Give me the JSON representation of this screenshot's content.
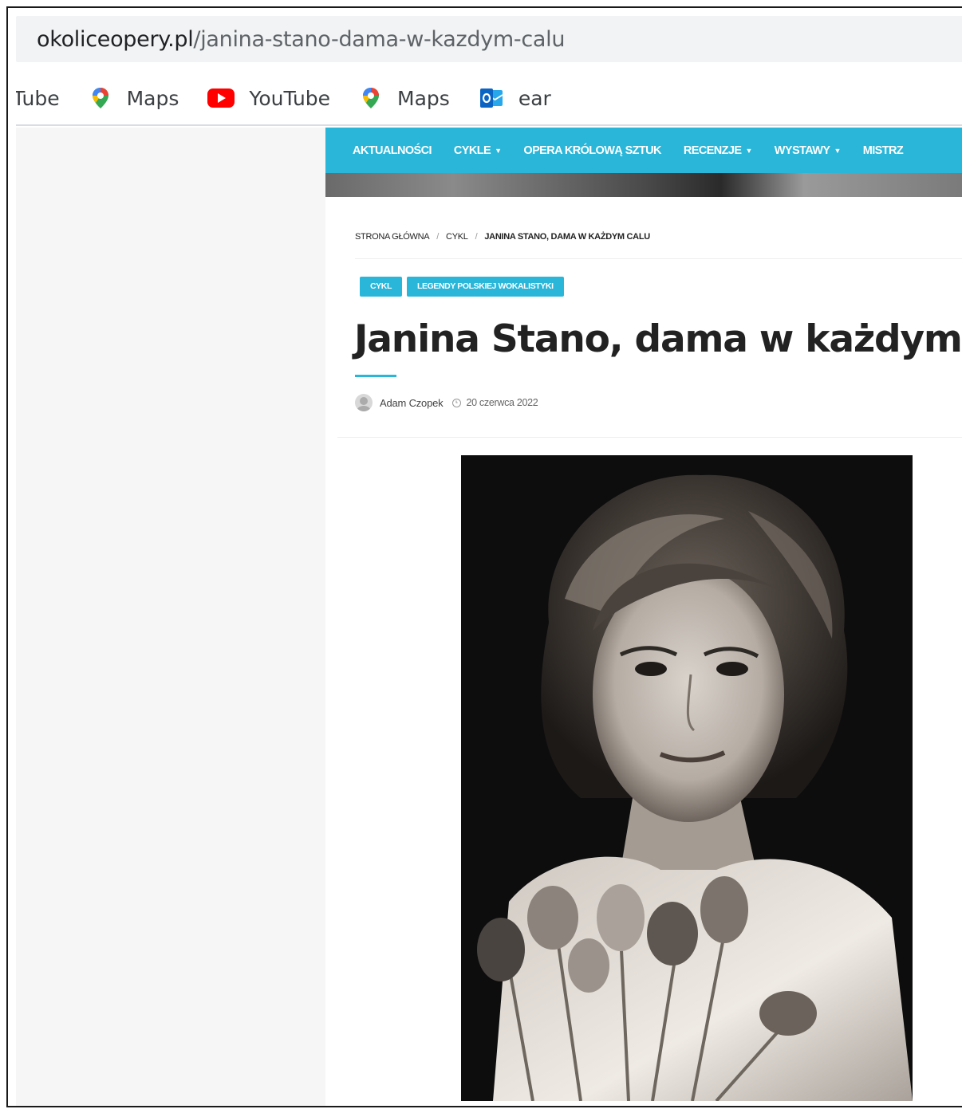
{
  "browser": {
    "url_domain": "okoliceopery.pl",
    "url_path": "/janina-stano-dama-w-kazdym-calu"
  },
  "bookmarks": [
    {
      "label": "Tube",
      "icon": "none"
    },
    {
      "label": "Maps",
      "icon": "google-maps-icon"
    },
    {
      "label": "YouTube",
      "icon": "youtube-icon"
    },
    {
      "label": "Maps",
      "icon": "google-maps-icon"
    },
    {
      "label": "ear",
      "icon": "outlook-icon"
    }
  ],
  "nav": {
    "items": [
      {
        "label": "AKTUALNOŚCI",
        "dropdown": false
      },
      {
        "label": "CYKLE",
        "dropdown": true
      },
      {
        "label": "OPERA KRÓLOWĄ SZTUK",
        "dropdown": false
      },
      {
        "label": "RECENZJE",
        "dropdown": true
      },
      {
        "label": "WYSTAWY",
        "dropdown": true
      },
      {
        "label": "MISTRZ",
        "dropdown": false
      }
    ],
    "color": "#29b6d9"
  },
  "breadcrumb": {
    "home": "STRONA GŁÓWNA",
    "section": "CYKL",
    "current": "JANINA STANO, DAMA W KAŻDYM CALU",
    "separator": "/"
  },
  "tags": [
    "CYKL",
    "LEGENDY POLSKIEJ WOKALISTYKI"
  ],
  "article": {
    "title": "Janina Stano, dama w każdym calu",
    "author": "Adam Czopek",
    "date": "20 czerwca 2022"
  },
  "colors": {
    "accent": "#29b6d9"
  }
}
